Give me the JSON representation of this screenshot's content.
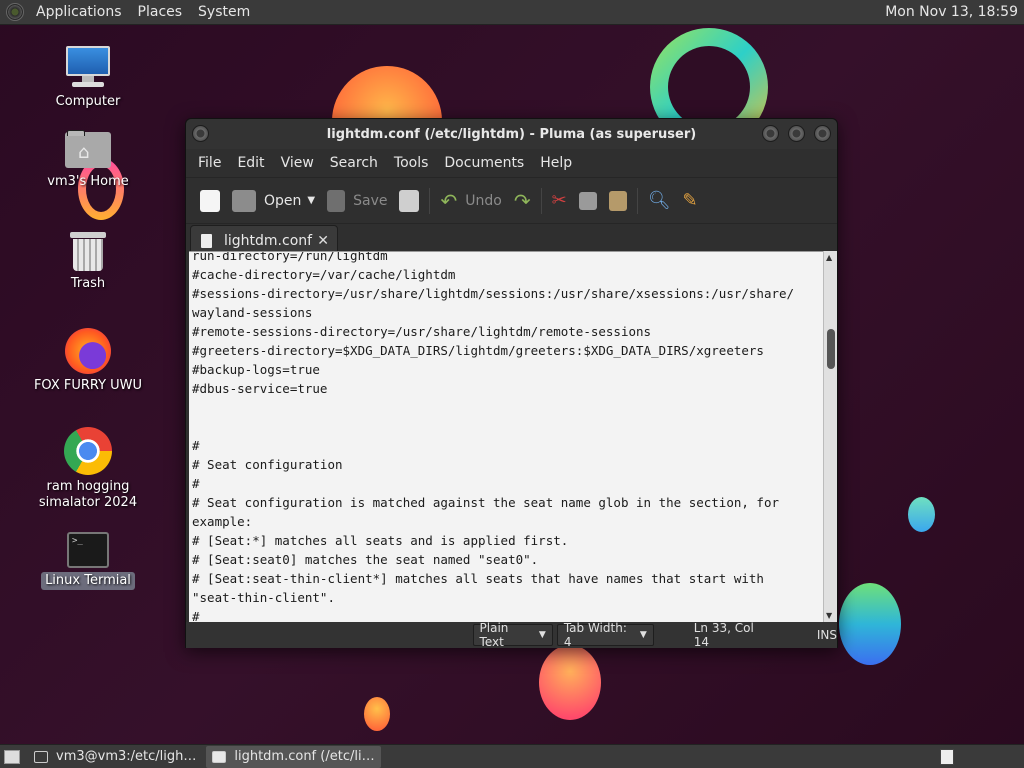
{
  "top_panel": {
    "menu": [
      "Applications",
      "Places",
      "System"
    ],
    "clock": "Mon Nov 13, 18:59"
  },
  "desktop_icons": [
    {
      "label": "Computer",
      "icon": "computer-icon"
    },
    {
      "label": "vm3's Home",
      "icon": "home-folder-icon"
    },
    {
      "label": "Trash",
      "icon": "trash-icon"
    },
    {
      "label": "FOX FURRY UWU",
      "icon": "firefox-icon"
    },
    {
      "label": "ram hogging simalator 2024",
      "icon": "chrome-icon"
    },
    {
      "label": "Linux Termial",
      "icon": "terminal-icon"
    }
  ],
  "window": {
    "title": "lightdm.conf (/etc/lightdm) - Pluma (as superuser)",
    "menus": [
      "File",
      "Edit",
      "View",
      "Search",
      "Tools",
      "Documents",
      "Help"
    ],
    "toolbar": {
      "open_label": "Open",
      "save_label": "Save",
      "undo_label": "Undo"
    },
    "tab": {
      "label": "lightdm.conf",
      "close": "✕"
    },
    "code": "run-directory=/run/lightdm\n#cache-directory=/var/cache/lightdm\n#sessions-directory=/usr/share/lightdm/sessions:/usr/share/xsessions:/usr/share/\nwayland-sessions\n#remote-sessions-directory=/usr/share/lightdm/remote-sessions\n#greeters-directory=$XDG_DATA_DIRS/lightdm/greeters:$XDG_DATA_DIRS/xgreeters\n#backup-logs=true\n#dbus-service=true\n\n\n#\n# Seat configuration\n#\n# Seat configuration is matched against the seat name glob in the section, for\nexample:\n# [Seat:*] matches all seats and is applied first.\n# [Seat:seat0] matches the seat named \"seat0\".\n# [Seat:seat-thin-client*] matches all seats that have names that start with\n\"seat-thin-client\".\n#\n# type = Seat type (local, xremote)",
    "status": {
      "language": "Plain Text",
      "tab_width": "Tab Width:  4",
      "position": "Ln 33, Col 14",
      "mode": "INS"
    }
  },
  "taskbar": [
    {
      "label": "vm3@vm3:/etc/ligh…",
      "icon": "terminal-icon",
      "active": false
    },
    {
      "label": "lightdm.conf (/etc/li…",
      "icon": "pluma-icon",
      "active": true
    }
  ]
}
